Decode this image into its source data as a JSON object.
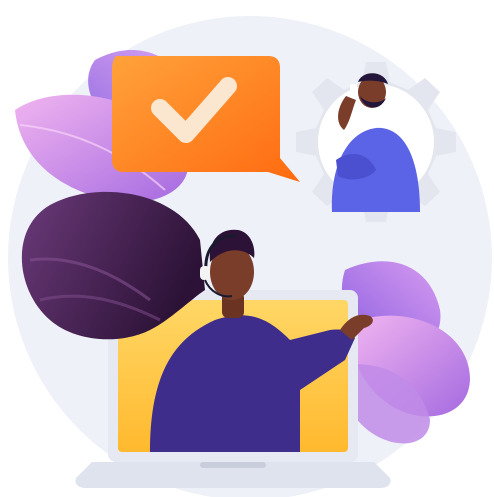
{
  "illustration": {
    "subject": "customer-support-confirmation",
    "icons": [
      "checkmark-icon",
      "gear-icon",
      "headset-icon",
      "phone-icon",
      "laptop-icon"
    ],
    "colors": {
      "background_circle": "#eef1f8",
      "bubble_orange": "#ff7a1a",
      "bubble_orange_light": "#ffa23a",
      "gear_gray": "#e3e6ee",
      "leaf_purple": "#b67be6",
      "leaf_pink": "#e9a4ee",
      "hair_dark": "#3b1c4a",
      "shirt_indigo": "#3f2d8c",
      "man_shirt": "#5b63e6",
      "laptop_screen": "#ffc84a",
      "laptop_body": "#e6e9f2",
      "skin": "#7a3d2a"
    }
  }
}
